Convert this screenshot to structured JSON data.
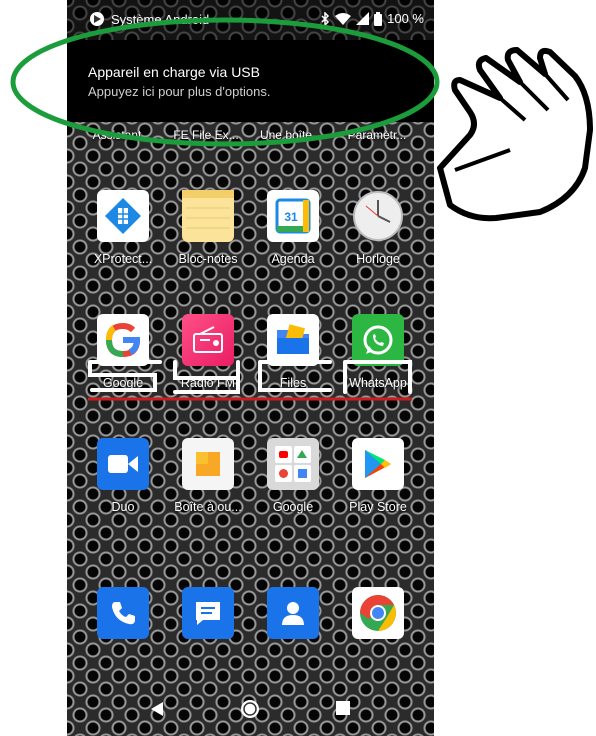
{
  "status_bar": {
    "system_label": "Système Android",
    "battery": "100 %"
  },
  "notification": {
    "title": "Appareil en charge via USB",
    "subtitle": "Appuyez ici pour plus d'options."
  },
  "top_row": [
    "Assistant",
    "FE File Ex...",
    "Une boîte...",
    "Paramètr..."
  ],
  "apps": {
    "row1": [
      {
        "label": "XProtect...",
        "icon": "xprotect-icon"
      },
      {
        "label": "Bloc-notes",
        "icon": "notepad-icon"
      },
      {
        "label": "Agenda",
        "icon": "calendar-icon",
        "day": "31"
      },
      {
        "label": "Horloge",
        "icon": "clock-icon"
      }
    ],
    "row2": [
      {
        "label": "Google",
        "icon": "google-icon"
      },
      {
        "label": "Radio FM",
        "icon": "radio-icon"
      },
      {
        "label": "Files",
        "icon": "files-icon"
      },
      {
        "label": "WhatsApp",
        "icon": "whatsapp-icon"
      }
    ],
    "row3": [
      {
        "label": "Duo",
        "icon": "duo-icon"
      },
      {
        "label": "Boîte à ou...",
        "icon": "toolbox-icon"
      },
      {
        "label": "Google",
        "icon": "google-folder-icon"
      },
      {
        "label": "Play Store",
        "icon": "play-store-icon"
      }
    ]
  },
  "dock": [
    "phone-icon",
    "messages-icon",
    "contacts-icon",
    "chrome-icon"
  ],
  "navigation": [
    "back-icon",
    "home-icon",
    "recents-icon"
  ],
  "colors": {
    "highlight_ellipse": "#1a9d3a",
    "underline": "#c81e1e",
    "notification_bg": "#000000"
  }
}
